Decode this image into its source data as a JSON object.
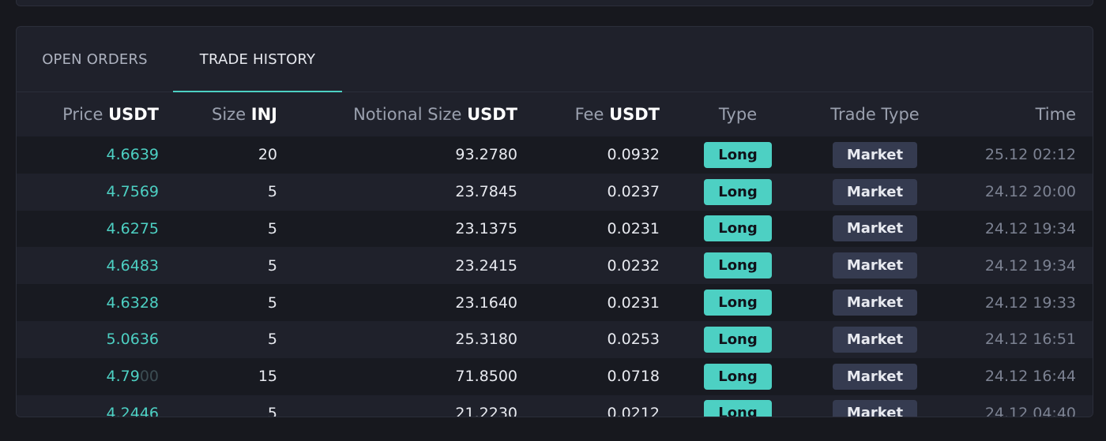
{
  "tabs": [
    {
      "label": "OPEN ORDERS",
      "active": false
    },
    {
      "label": "TRADE HISTORY",
      "active": true
    }
  ],
  "headers": {
    "price": {
      "label": "Price",
      "unit": "USDT"
    },
    "size": {
      "label": "Size",
      "unit": "INJ"
    },
    "notional": {
      "label": "Notional Size",
      "unit": "USDT"
    },
    "fee": {
      "label": "Fee",
      "unit": "USDT"
    },
    "type": {
      "label": "Type"
    },
    "trade_type": {
      "label": "Trade Type"
    },
    "time": {
      "label": "Time"
    }
  },
  "rows": [
    {
      "price": "4.6639",
      "price_dim": "",
      "size": "20",
      "notional": "93.2780",
      "fee": "0.0932",
      "type": "Long",
      "trade_type": "Market",
      "time": "25.12 02:12"
    },
    {
      "price": "4.7569",
      "price_dim": "",
      "size": "5",
      "notional": "23.7845",
      "fee": "0.0237",
      "type": "Long",
      "trade_type": "Market",
      "time": "24.12 20:00"
    },
    {
      "price": "4.6275",
      "price_dim": "",
      "size": "5",
      "notional": "23.1375",
      "fee": "0.0231",
      "type": "Long",
      "trade_type": "Market",
      "time": "24.12 19:34"
    },
    {
      "price": "4.6483",
      "price_dim": "",
      "size": "5",
      "notional": "23.2415",
      "fee": "0.0232",
      "type": "Long",
      "trade_type": "Market",
      "time": "24.12 19:34"
    },
    {
      "price": "4.6328",
      "price_dim": "",
      "size": "5",
      "notional": "23.1640",
      "fee": "0.0231",
      "type": "Long",
      "trade_type": "Market",
      "time": "24.12 19:33"
    },
    {
      "price": "5.0636",
      "price_dim": "",
      "size": "5",
      "notional": "25.3180",
      "fee": "0.0253",
      "type": "Long",
      "trade_type": "Market",
      "time": "24.12 16:51"
    },
    {
      "price": "4.79",
      "price_dim": "00",
      "size": "15",
      "notional": "71.8500",
      "fee": "0.0718",
      "type": "Long",
      "trade_type": "Market",
      "time": "24.12 16:44"
    },
    {
      "price": "4.2446",
      "price_dim": "",
      "size": "5",
      "notional": "21.2230",
      "fee": "0.0212",
      "type": "Long",
      "trade_type": "Market",
      "time": "24.12 04:40"
    }
  ],
  "colors": {
    "accent": "#4dd0c3",
    "background": "#17181e",
    "panel": "#1f212b",
    "badge_market": "#353b50"
  }
}
